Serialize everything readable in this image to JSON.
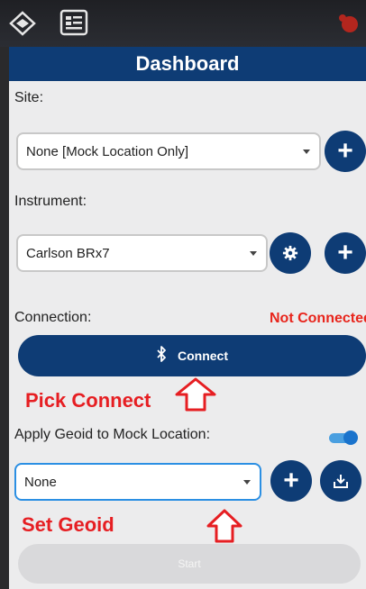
{
  "header": {
    "title": "Dashboard"
  },
  "site": {
    "label": "Site:",
    "selected": "None [Mock Location Only]",
    "add_symbol": "+"
  },
  "instrument": {
    "label": "Instrument:",
    "selected": "Carlson BRx7",
    "add_symbol": "+"
  },
  "connection": {
    "label": "Connection:",
    "status": "Not Connected",
    "status_color": "#e8251c",
    "connect_label": "Connect",
    "bluetooth_symbol": "∦"
  },
  "geoid": {
    "toggle_label": "Apply Geoid to Mock Location:",
    "toggle_on": true,
    "selected": "None",
    "add_symbol": "+"
  },
  "annotations": {
    "pick_connect": "Pick Connect",
    "set_geoid": "Set Geoid",
    "color": "#e61e22"
  },
  "start": {
    "label": "Start"
  },
  "colors": {
    "primary": "#0e3c75",
    "accent": "#2b8fe3"
  }
}
